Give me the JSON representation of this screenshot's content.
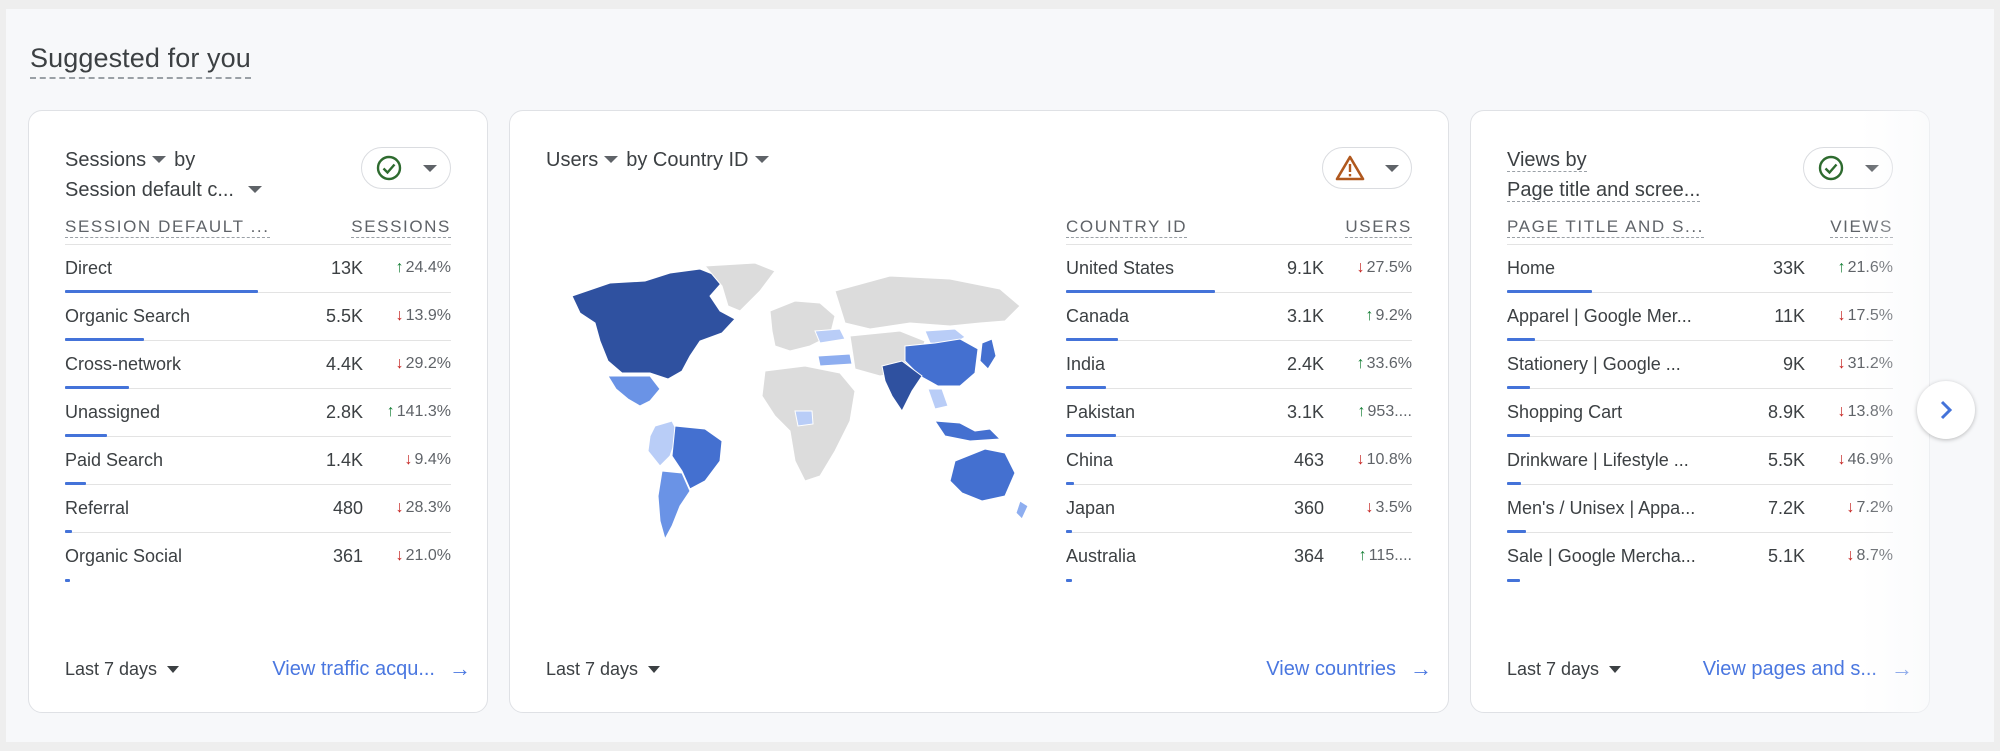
{
  "section": {
    "title": "Suggested for you"
  },
  "colors": {
    "accent": "#4473d9",
    "link": "#4a77e0",
    "up": "#188038",
    "down": "#c5221f",
    "status_ok": "#2e6b2f",
    "status_warn": "#b0581e",
    "map_no_data": "#dcdcdc",
    "map_scale": [
      "#b9cdf7",
      "#8eaef0",
      "#6a93e6",
      "#4470d0",
      "#2f51a0"
    ]
  },
  "cards": [
    {
      "title_metric": "Sessions",
      "title_by": "by",
      "title_dimension": "Session default c...",
      "status_icon": "check-circle-icon",
      "col_dim": "SESSION DEFAULT ...",
      "col_metric": "SESSIONS",
      "rows": [
        {
          "label": "Direct",
          "value": "13K",
          "change": "24.4%",
          "dir": "up",
          "share": 0.5
        },
        {
          "label": "Organic Search",
          "value": "5.5K",
          "change": "13.9%",
          "dir": "down",
          "share": 0.205
        },
        {
          "label": "Cross-network",
          "value": "4.4K",
          "change": "29.2%",
          "dir": "down",
          "share": 0.165
        },
        {
          "label": "Unassigned",
          "value": "2.8K",
          "change": "141.3%",
          "dir": "up",
          "share": 0.108
        },
        {
          "label": "Paid Search",
          "value": "1.4K",
          "change": "9.4%",
          "dir": "down",
          "share": 0.054
        },
        {
          "label": "Referral",
          "value": "480",
          "change": "28.3%",
          "dir": "down",
          "share": 0.018
        },
        {
          "label": "Organic Social",
          "value": "361",
          "change": "21.0%",
          "dir": "down",
          "share": 0.014
        }
      ],
      "date_range": "Last 7 days",
      "link": "View traffic acqu..."
    },
    {
      "title_metric": "Users",
      "title_by": "by Country ID",
      "status_icon": "warning-icon",
      "col_dim": "COUNTRY ID",
      "col_metric": "USERS",
      "rows": [
        {
          "label": "United States",
          "value": "9.1K",
          "change": "27.5%",
          "dir": "down",
          "share": 0.43
        },
        {
          "label": "Canada",
          "value": "3.1K",
          "change": "9.2%",
          "dir": "up",
          "share": 0.15
        },
        {
          "label": "India",
          "value": "2.4K",
          "change": "33.6%",
          "dir": "up",
          "share": 0.115
        },
        {
          "label": "Pakistan",
          "value": "3.1K",
          "change": "953....",
          "dir": "up",
          "share": 0.145
        },
        {
          "label": "China",
          "value": "463",
          "change": "10.8%",
          "dir": "down",
          "share": 0.022
        },
        {
          "label": "Japan",
          "value": "360",
          "change": "3.5%",
          "dir": "down",
          "share": 0.017
        },
        {
          "label": "Australia",
          "value": "364",
          "change": "115....",
          "dir": "up",
          "share": 0.017
        }
      ],
      "date_range": "Last 7 days",
      "link": "View countries"
    },
    {
      "title_metric": "Views by",
      "title_dimension": "Page title and scree...",
      "status_icon": "check-circle-icon",
      "col_dim": "PAGE TITLE AND S...",
      "col_metric": "VIEWS",
      "rows": [
        {
          "label": "Home",
          "value": "33K",
          "change": "21.6%",
          "dir": "up",
          "share": 0.22
        },
        {
          "label": "Apparel | Google Mer...",
          "value": "11K",
          "change": "17.5%",
          "dir": "down",
          "share": 0.073
        },
        {
          "label": "Stationery | Google ...",
          "value": "9K",
          "change": "31.2%",
          "dir": "down",
          "share": 0.06
        },
        {
          "label": "Shopping Cart",
          "value": "8.9K",
          "change": "13.8%",
          "dir": "down",
          "share": 0.059
        },
        {
          "label": "Drinkware | Lifestyle ...",
          "value": "5.5K",
          "change": "46.9%",
          "dir": "down",
          "share": 0.037
        },
        {
          "label": "Men's / Unisex | Appa...",
          "value": "7.2K",
          "change": "7.2%",
          "dir": "down",
          "share": 0.048
        },
        {
          "label": "Sale | Google Mercha...",
          "value": "5.1K",
          "change": "8.7%",
          "dir": "down",
          "share": 0.034
        }
      ],
      "date_range": "Last 7 days",
      "link": "View pages and s..."
    }
  ],
  "map": {
    "regions": [
      {
        "name": "North America (US/Canada)",
        "level": 4
      },
      {
        "name": "Mexico",
        "level": 2
      },
      {
        "name": "Colombia/Peru",
        "level": 0
      },
      {
        "name": "Brazil",
        "level": 3
      },
      {
        "name": "Argentina/Chile",
        "level": 2
      },
      {
        "name": "Greenland",
        "level": -1
      },
      {
        "name": "Europe",
        "level": -1
      },
      {
        "name": "Ukraine",
        "level": 0
      },
      {
        "name": "Turkey",
        "level": 1
      },
      {
        "name": "Africa",
        "level": -1
      },
      {
        "name": "Nigeria",
        "level": 0
      },
      {
        "name": "Russia",
        "level": -1
      },
      {
        "name": "Middle East / Central Asia",
        "level": -1
      },
      {
        "name": "India / Pakistan",
        "level": 4
      },
      {
        "name": "China",
        "level": 3
      },
      {
        "name": "Mongolia",
        "level": 0
      },
      {
        "name": "Japan / Korea",
        "level": 3
      },
      {
        "name": "Southeast Asia",
        "level": 0
      },
      {
        "name": "Indonesia / Malaysia",
        "level": 3
      },
      {
        "name": "Australia",
        "level": 3
      },
      {
        "name": "New Zealand",
        "level": 1
      }
    ]
  },
  "nav": {
    "next_label": "Next"
  }
}
